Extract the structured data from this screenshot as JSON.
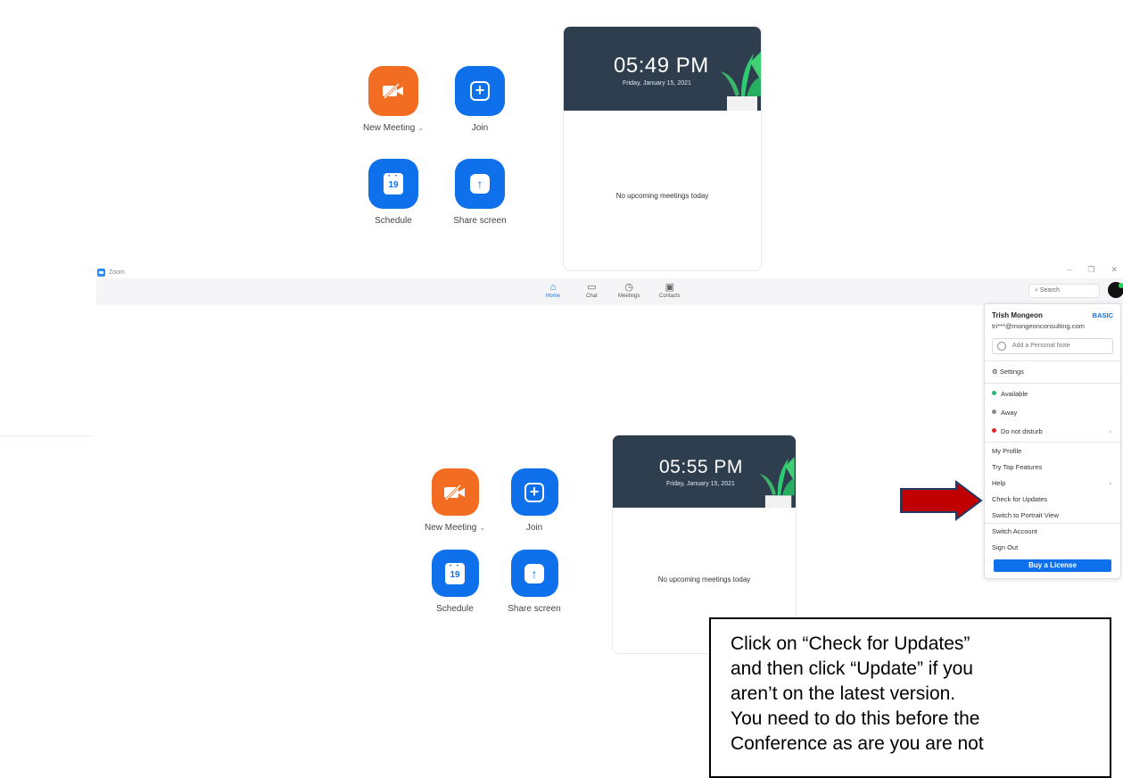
{
  "top_panel": {
    "new_meeting_label": "New Meeting",
    "join_label": "Join",
    "schedule_label": "Schedule",
    "share_screen_label": "Share screen",
    "calendar_day": "19",
    "time": "05:49 PM",
    "date": "Friday, January 15, 2021",
    "no_meetings": "No upcoming meetings today"
  },
  "window": {
    "title": "Zoom",
    "controls": {
      "minimize": "–",
      "restore": "❐",
      "close": "✕"
    }
  },
  "nav": {
    "home": "Home",
    "chat": "Chat",
    "meetings": "Meetings",
    "contacts": "Contacts"
  },
  "search": {
    "placeholder": "Search"
  },
  "main_panel": {
    "new_meeting_label": "New Meeting",
    "join_label": "Join",
    "schedule_label": "Schedule",
    "share_screen_label": "Share screen",
    "calendar_day": "19",
    "time": "05:55 PM",
    "date": "Friday, January 15, 2021",
    "no_meetings": "No upcoming meetings today"
  },
  "menu": {
    "user_name": "Trish Mongeon",
    "plan": "BASIC",
    "email": "tri***@mongeonconsulting.com",
    "note_placeholder": "Add a Personal Note",
    "settings": "Settings",
    "available": "Available",
    "away": "Away",
    "do_not_disturb": "Do not disturb",
    "my_profile": "My Profile",
    "try_top_features": "Try Top Features",
    "help": "Help",
    "check_for_updates": "Check for Updates",
    "switch_portrait": "Switch to Portrait View",
    "switch_account": "Switch Account",
    "sign_out": "Sign Out",
    "buy_license": "Buy a License"
  },
  "callout": {
    "line1": "Click on “Check for Updates”",
    "line2": "and then click “Update” if you",
    "line3": "aren’t on the latest version.",
    "line4": "You need to do this before the",
    "line5": "Conference as are you are not"
  },
  "colors": {
    "orange": "#f26d21",
    "blue": "#0e71eb",
    "card_header": "#2f3e4f",
    "arrow_red": "#c00000",
    "arrow_outline": "#1f3864"
  }
}
